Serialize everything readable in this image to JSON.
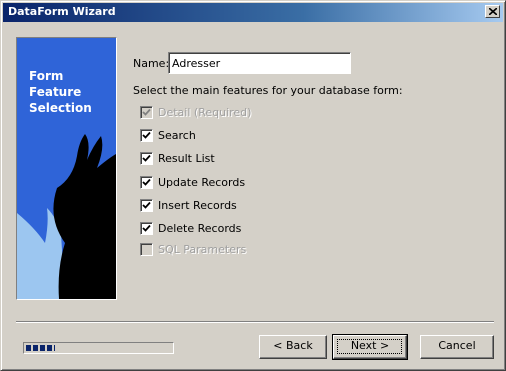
{
  "window": {
    "title": "DataForm Wizard"
  },
  "side_panel": {
    "title": "Form Feature Selection"
  },
  "name": {
    "label": "Name:",
    "value": "Adresser"
  },
  "features_label": "Select the main features for your database form:",
  "features": [
    {
      "label": "Detail (Required)",
      "checked": true,
      "enabled": false
    },
    {
      "label": "Search",
      "checked": true,
      "enabled": true
    },
    {
      "label": "Result List",
      "checked": true,
      "enabled": true
    },
    {
      "label": "Update Records",
      "checked": true,
      "enabled": true
    },
    {
      "label": "Insert Records",
      "checked": true,
      "enabled": true
    },
    {
      "label": "Delete Records",
      "checked": true,
      "enabled": true
    },
    {
      "label": "SQL Parameters",
      "checked": false,
      "enabled": false
    }
  ],
  "progress": {
    "fraction": 0.2
  },
  "buttons": {
    "back": "< Back",
    "next": "Next >",
    "cancel": "Cancel"
  },
  "colors": {
    "title_bar": "#0a246a",
    "panel_blue": "#2f64d8",
    "face": "#d4d0c8"
  },
  "icons": {
    "close": "close-icon",
    "check": "checkmark-icon"
  }
}
